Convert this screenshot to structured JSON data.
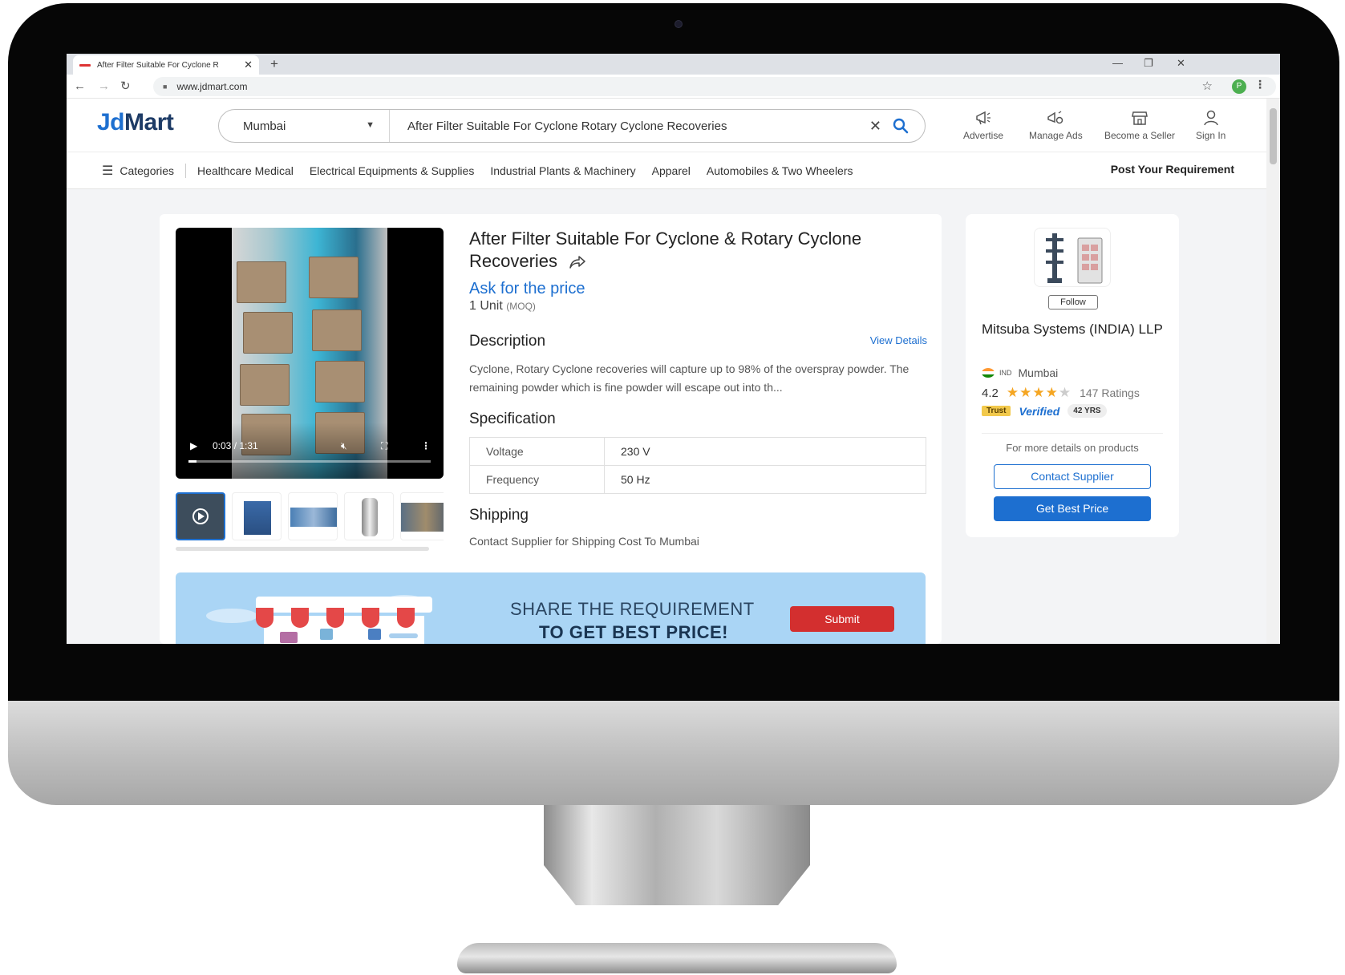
{
  "browser": {
    "tab_title": "After Filter Suitable For Cyclone R",
    "url": "www.jdmart.com",
    "profile_initial": "P"
  },
  "header": {
    "logo_jd": "Jd",
    "logo_mart": "Mart",
    "city": "Mumbai",
    "search_query": "After Filter Suitable For Cyclone Rotary Cyclone Recoveries",
    "actions": [
      "Advertise",
      "Manage Ads",
      "Become a Seller",
      "Sign In"
    ]
  },
  "nav": {
    "categories_label": "Categories",
    "links": [
      "Healthcare Medical",
      "Electrical Equipments & Supplies",
      "Industrial Plants & Machinery",
      "Apparel",
      "Automobiles & Two Wheelers"
    ],
    "post_requirement": "Post Your Requirement"
  },
  "product": {
    "title": "After Filter Suitable For Cyclone & Rotary Cyclone Recoveries",
    "price_label": "Ask for the price",
    "moq_value": "1 Unit",
    "moq_tag": "(MOQ)",
    "description_heading": "Description",
    "view_details": "View Details",
    "description": "Cyclone, Rotary Cyclone recoveries will capture up to 98% of the overspray powder. The remaining powder which is fine powder will escape out into th...",
    "specification_heading": "Specification",
    "specifications": [
      {
        "key": "Voltage",
        "value": "230 V"
      },
      {
        "key": "Frequency",
        "value": "50 Hz"
      }
    ],
    "shipping_heading": "Shipping",
    "shipping_text": "Contact Supplier for Shipping Cost To Mumbai",
    "video": {
      "time": "0:03 / 1:31",
      "progress": 0.033
    }
  },
  "banner": {
    "line1": "SHARE THE REQUIREMENT",
    "line2": "TO GET BEST PRICE!",
    "submit": "Submit"
  },
  "seller": {
    "follow": "Follow",
    "name": "Mitsuba Systems (INDIA) LLP",
    "country_code": "IND",
    "city": "Mumbai",
    "rating": "4.2",
    "stars": 4,
    "ratings_count": "147 Ratings",
    "trust_badge": "Trust",
    "verified_badge": "Verified",
    "years_badge": "42 YRS",
    "more_details": "For more details on products",
    "contact_button": "Contact Supplier",
    "best_price_button": "Get Best Price"
  },
  "colors": {
    "brand_blue": "#1d6fd0",
    "submit_red": "#d32f2f",
    "banner_bg": "#aad5f5"
  }
}
